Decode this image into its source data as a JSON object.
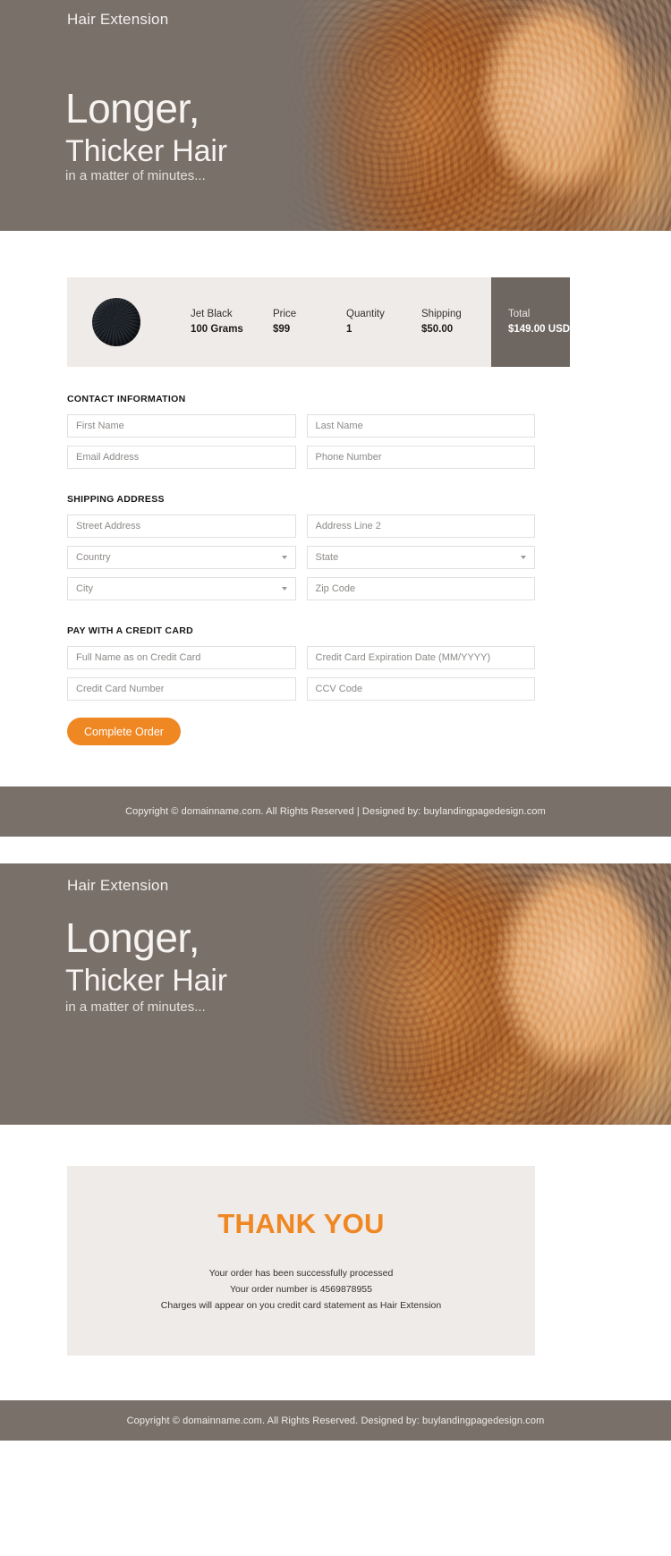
{
  "hero": {
    "brand": "Hair Extension",
    "headline_line1": "Longer,",
    "headline_line2": "Thicker Hair",
    "subline": "in a matter of minutes..."
  },
  "summary": {
    "swatch_name": "jet-black-hair-swatch",
    "columns": [
      {
        "label": "Jet Black",
        "value": "100 Grams"
      },
      {
        "label": "Price",
        "value": "$99"
      },
      {
        "label": "Quantity",
        "value": "1"
      },
      {
        "label": "Shipping",
        "value": "$50.00"
      }
    ],
    "total": {
      "label": "Total",
      "value": "$149.00 USD"
    }
  },
  "form": {
    "contact_title": "CONTACT INFORMATION",
    "contact_fields": [
      {
        "placeholder": "First Name",
        "type": "text"
      },
      {
        "placeholder": "Last Name",
        "type": "text"
      },
      {
        "placeholder": "Email Address",
        "type": "text"
      },
      {
        "placeholder": "Phone Number",
        "type": "text"
      }
    ],
    "shipping_title": "SHIPPING ADDRESS",
    "shipping_fields": [
      {
        "placeholder": "Street Address",
        "type": "text"
      },
      {
        "placeholder": "Address Line 2",
        "type": "text"
      },
      {
        "placeholder": "Country",
        "type": "select"
      },
      {
        "placeholder": "State",
        "type": "select"
      },
      {
        "placeholder": "City",
        "type": "select"
      },
      {
        "placeholder": "Zip Code",
        "type": "text"
      }
    ],
    "payment_title": "PAY WITH A CREDIT CARD",
    "payment_fields": [
      {
        "placeholder": "Full Name as on Credit Card",
        "type": "text"
      },
      {
        "placeholder": "Credit Card Expiration Date (MM/YYYY)",
        "type": "text"
      },
      {
        "placeholder": "Credit Card Number",
        "type": "text"
      },
      {
        "placeholder": "CCV Code",
        "type": "text"
      }
    ],
    "submit_label": "Complete Order"
  },
  "footer_top": {
    "text": "Copyright © domainname.com. All Rights Reserved  |  Designed by: buylandingpagedesign.com"
  },
  "thanks": {
    "title": "THANK YOU",
    "line1": "Your order has been successfully processed",
    "line2": "Your order number is 4569878955",
    "line3": "Charges will appear on you credit card statement as Hair Extension"
  },
  "footer_bottom": {
    "text": "Copyright © domainname.com. All Rights Reserved. Designed by: buylandingpagedesign.com"
  },
  "colors": {
    "hero_bg": "#79706a",
    "accent_orange": "#ef8722",
    "panel_beige": "#efebe8",
    "total_dark": "#6e6660"
  }
}
